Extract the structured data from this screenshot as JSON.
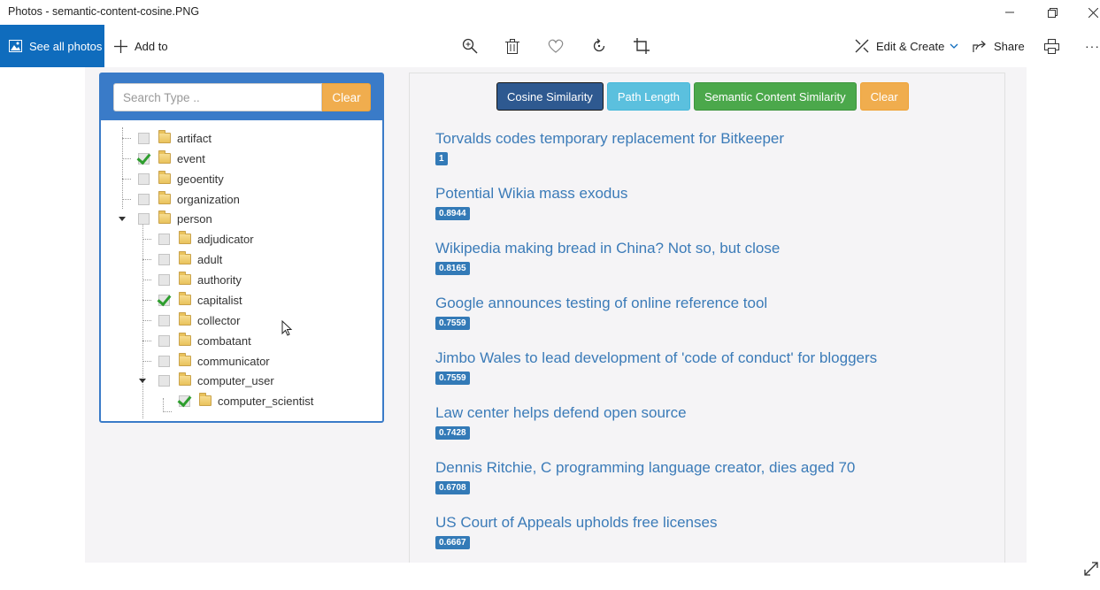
{
  "window": {
    "title": "Photos - semantic-content-cosine.PNG"
  },
  "toolbar": {
    "see_all_label": "See all photos",
    "add_to_label": "Add to",
    "edit_create_label": "Edit & Create",
    "share_label": "Share",
    "more_label": "···"
  },
  "left": {
    "search_placeholder": "Search Type ..",
    "clear_label": "Clear",
    "tree": [
      {
        "label": "artifact",
        "checked": false
      },
      {
        "label": "event",
        "checked": true
      },
      {
        "label": "geoentity",
        "checked": false
      },
      {
        "label": "organization",
        "checked": false
      },
      {
        "label": "person",
        "checked": false
      },
      {
        "label": "adjudicator",
        "checked": false
      },
      {
        "label": "adult",
        "checked": false
      },
      {
        "label": "authority",
        "checked": false
      },
      {
        "label": "capitalist",
        "checked": true
      },
      {
        "label": "collector",
        "checked": false
      },
      {
        "label": "combatant",
        "checked": false
      },
      {
        "label": "communicator",
        "checked": false
      },
      {
        "label": "computer_user",
        "checked": false
      },
      {
        "label": "computer_scientist",
        "checked": true
      }
    ]
  },
  "right": {
    "buttons": {
      "cosine": "Cosine Similarity",
      "path": "Path Length",
      "semantic": "Semantic Content Similarity",
      "clear": "Clear"
    },
    "results": [
      {
        "title": "Torvalds codes temporary replacement for Bitkeeper",
        "score": "1"
      },
      {
        "title": "Potential Wikia mass exodus",
        "score": "0.8944"
      },
      {
        "title": "Wikipedia making bread in China? Not so, but close",
        "score": "0.8165"
      },
      {
        "title": "Google announces testing of online reference tool",
        "score": "0.7559"
      },
      {
        "title": "Jimbo Wales to lead development of 'code of conduct' for bloggers",
        "score": "0.7559"
      },
      {
        "title": "Law center helps defend open source",
        "score": "0.7428"
      },
      {
        "title": "Dennis Ritchie, C programming language creator, dies aged 70",
        "score": "0.6708"
      },
      {
        "title": "US Court of Appeals upholds free licenses",
        "score": "0.6667"
      }
    ]
  }
}
